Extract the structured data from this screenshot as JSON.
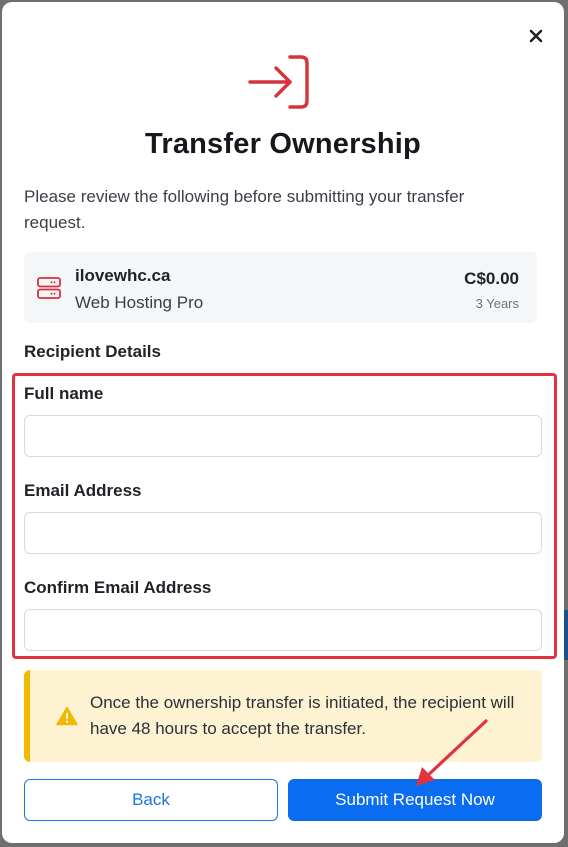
{
  "dialog": {
    "title": "Transfer Ownership",
    "intro": "Please review the following before submitting your transfer request.",
    "close_icon": "close-icon",
    "hero_icon": "transfer-arrow-icon",
    "accent_color": "#d6333f"
  },
  "summary": {
    "domain": "ilovewhc.ca",
    "plan": "Web Hosting Pro",
    "price": "C$0.00",
    "term": "3 Years",
    "icon": "server-icon"
  },
  "recipient": {
    "heading": "Recipient Details",
    "full_name": {
      "label": "Full name",
      "value": "",
      "placeholder": ""
    },
    "email": {
      "label": "Email Address",
      "value": "",
      "placeholder": ""
    },
    "confirm_email": {
      "label": "Confirm Email Address",
      "value": "",
      "placeholder": ""
    },
    "highlight_color": "#e0333f"
  },
  "alert": {
    "icon": "warning-icon",
    "text": "Once the ownership transfer is initiated, the recipient will have 48 hours to accept the transfer.",
    "color": "#f5b800"
  },
  "actions": {
    "back_label": "Back",
    "submit_label": "Submit Request Now",
    "primary_color": "#0a6cf0"
  }
}
